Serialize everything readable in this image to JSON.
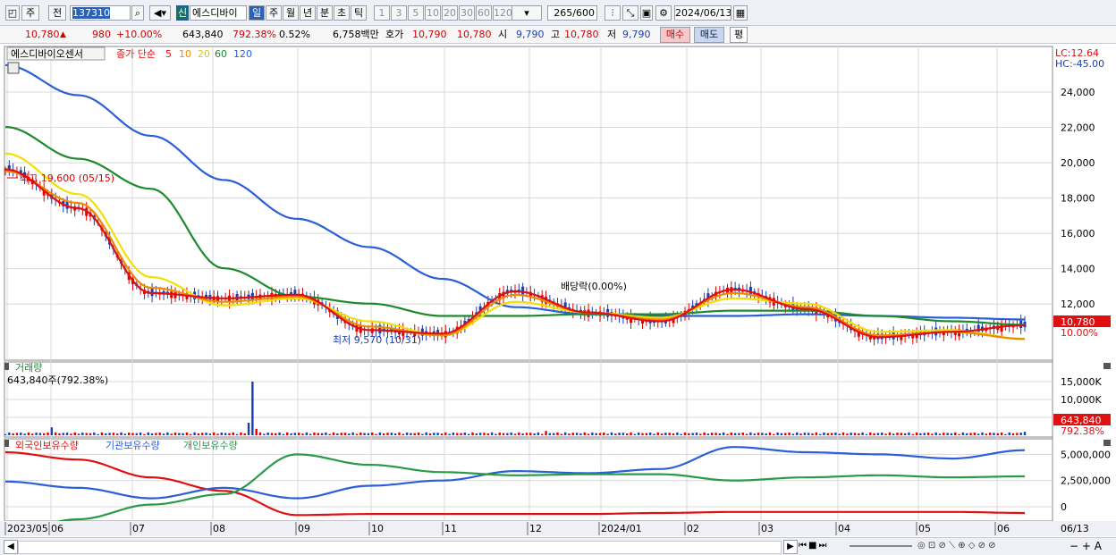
{
  "toolbar": {
    "period_buttons": [
      "주",
      "전"
    ],
    "code": "137310",
    "stock_name_badge": "신",
    "stock_name": "에스디바이",
    "period_tabs": [
      "일",
      "주",
      "월",
      "년",
      "분",
      "초",
      "틱"
    ],
    "minute_tabs": [
      "1",
      "3",
      "5",
      "10",
      "20",
      "30",
      "60",
      "120"
    ],
    "count": "265",
    "count_total": "/600",
    "date": "2024/06/13"
  },
  "quote": {
    "price": "10,780",
    "arrow": "▲",
    "change": "980",
    "change_pct": "+10.00%",
    "volume": "643,840",
    "volume_ratio": "792.38%",
    "turnover_pct": "0.52%",
    "amount": "6,758백만",
    "hoga_label": "호가",
    "hoga_sell": "10,790",
    "hoga_buy": "10,780",
    "open_label": "시",
    "open": "9,790",
    "high_label": "고",
    "high": "10,780",
    "low_label": "저",
    "low": "9,790",
    "buy_button": "매수",
    "sell_button": "매도",
    "eval_button": "평"
  },
  "price_panel": {
    "title": "에스디바이오센서",
    "ma_label": "종가 단순",
    "ma_periods": [
      "5",
      "10",
      "20",
      "60",
      "120"
    ],
    "lc": "LC:12.64",
    "hc": "HC:-45.00",
    "high_annotation": "최고 19,600 (05/15)",
    "low_annotation": "최저 9,570 (10/31)",
    "dividend_annotation": "배당락(0.00%)",
    "current_price_tag": "10,780",
    "pct_tag": "10.00%",
    "yaxis_ticks": [
      "24,000",
      "22,000",
      "20,000",
      "18,000",
      "16,000",
      "14,000",
      "12,000"
    ]
  },
  "volume_panel": {
    "title": "거래량",
    "readout": "643,840주(792.38%)",
    "yaxis_ticks": [
      "15,000K",
      "10,000K",
      "5,000K"
    ],
    "current_tag": "643,840",
    "pct_tag": "792.38%"
  },
  "holding_panel": {
    "legend": [
      "외국인보유수량",
      "기관보유수량",
      "개인보유수량"
    ],
    "yaxis_ticks": [
      "5,000,000",
      "2,500,000",
      "0"
    ]
  },
  "xaxis_labels": [
    "2023/05",
    "06",
    "07",
    "08",
    "09",
    "10",
    "11",
    "12",
    "2024/01",
    "02",
    "03",
    "04",
    "05",
    "06",
    "06/13"
  ],
  "colors": {
    "ma5": "#e01010",
    "ma10": "#f28a00",
    "ma20": "#f2e000",
    "ma60": "#1e8a2e",
    "ma120": "#2a5fd8",
    "up": "#e00000",
    "down": "#1a3fb4",
    "foreign": "#e01010",
    "institution": "#2a5fd8",
    "individual": "#2a9a4a"
  },
  "chart_data": {
    "type": "line",
    "title": "에스디바이오센서",
    "x": [
      "2023/05",
      "06",
      "07",
      "08",
      "09",
      "10",
      "11",
      "12",
      "2024/01",
      "02",
      "03",
      "04",
      "05",
      "06",
      "06/13"
    ],
    "ylim": [
      9000,
      26000
    ],
    "series": [
      {
        "name": "5",
        "values": [
          19600,
          17400,
          12600,
          12300,
          12500,
          10500,
          10300,
          12700,
          11500,
          11000,
          12800,
          11700,
          10100,
          10400,
          10780
        ]
      },
      {
        "name": "10",
        "values": [
          19500,
          17700,
          12900,
          12100,
          12400,
          10700,
          10200,
          12500,
          11500,
          11100,
          12600,
          11800,
          10200,
          10400,
          10000
        ]
      },
      {
        "name": "20",
        "values": [
          20500,
          18200,
          13500,
          11900,
          12300,
          11000,
          10200,
          12100,
          11500,
          11200,
          12300,
          12000,
          10400,
          10500,
          10000
        ]
      },
      {
        "name": "60",
        "values": [
          22000,
          20200,
          18500,
          14000,
          12400,
          12000,
          11300,
          11300,
          11400,
          11400,
          11600,
          11600,
          11300,
          11000,
          10800
        ]
      },
      {
        "name": "120",
        "values": [
          25500,
          23800,
          21500,
          19000,
          16800,
          15200,
          13400,
          11800,
          11400,
          11300,
          11300,
          11400,
          11300,
          11200,
          11100
        ]
      }
    ],
    "volume": {
      "name": "거래량",
      "peak": 15000000,
      "current": 643840
    },
    "holdings": [
      {
        "name": "외국인보유수량",
        "values": [
          5200000,
          4500000,
          2800000,
          1500000,
          -800000,
          -700000,
          -700000,
          -700000,
          -700000,
          -600000,
          -500000,
          -500000,
          -500000,
          -500000,
          -600000
        ]
      },
      {
        "name": "기관보유수량",
        "values": [
          2400000,
          1800000,
          800000,
          1800000,
          800000,
          2000000,
          2500000,
          3400000,
          3200000,
          3600000,
          5700000,
          5200000,
          5000000,
          4600000,
          5400000
        ]
      },
      {
        "name": "개인보유수량",
        "values": [
          -2500000,
          -1200000,
          200000,
          1200000,
          5000000,
          4000000,
          3300000,
          3000000,
          3100000,
          3100000,
          2500000,
          2800000,
          3000000,
          2800000,
          2900000
        ]
      }
    ]
  }
}
